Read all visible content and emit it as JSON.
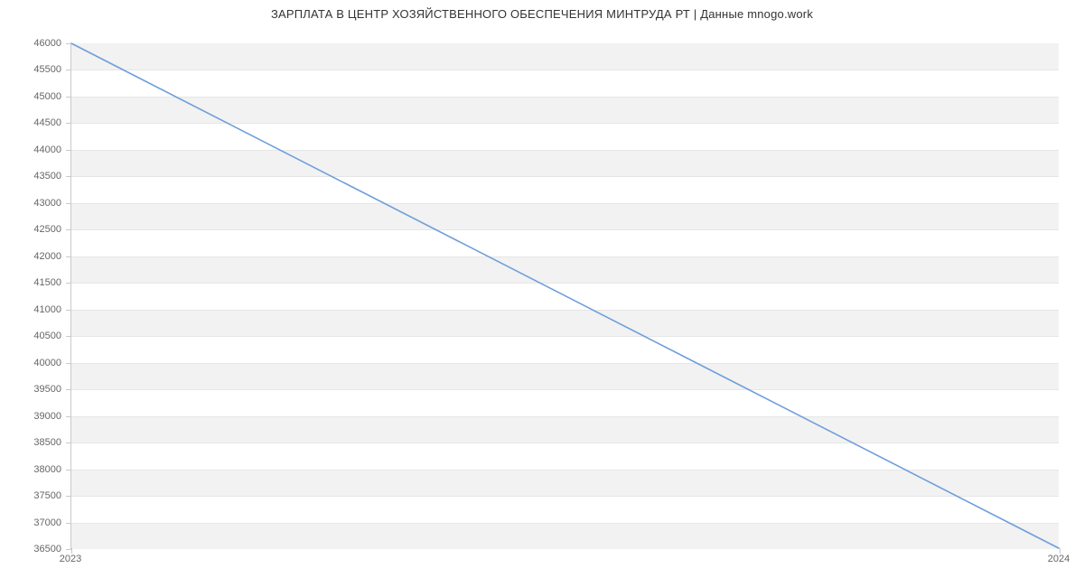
{
  "chart_data": {
    "type": "line",
    "title": "ЗАРПЛАТА В ЦЕНТР ХОЗЯЙСТВЕННОГО ОБЕСПЕЧЕНИЯ МИНТРУДА РТ | Данные mnogo.work",
    "xlabel": "",
    "ylabel": "",
    "x_ticks": [
      "2023",
      "2024"
    ],
    "y_ticks": [
      36500,
      37000,
      37500,
      38000,
      38500,
      39000,
      39500,
      40000,
      40500,
      41000,
      41500,
      42000,
      42500,
      43000,
      43500,
      44000,
      44500,
      45000,
      45500,
      46000
    ],
    "ylim": [
      36500,
      46000
    ],
    "x": [
      "2023",
      "2024"
    ],
    "values": [
      46000,
      36500
    ],
    "line_color": "#6f9edb",
    "band_color": "#f2f2f2"
  }
}
